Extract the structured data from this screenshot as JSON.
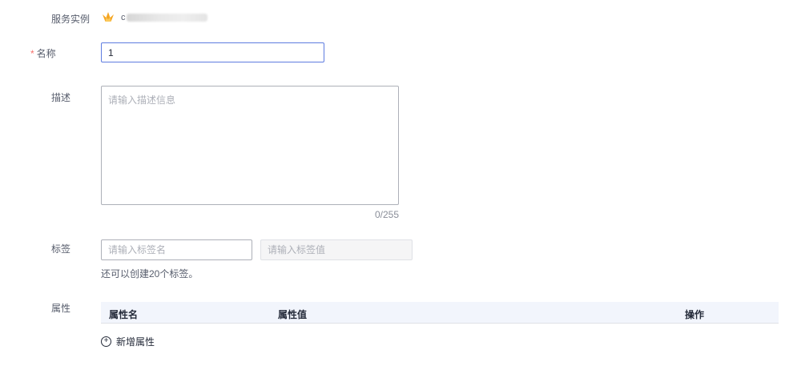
{
  "form": {
    "instance": {
      "label": "服务实例",
      "icon": "crown-icon",
      "value_prefix": "c"
    },
    "name": {
      "required_mark": "*",
      "label": "名称",
      "value": "1"
    },
    "description": {
      "label": "描述",
      "placeholder": "请输入描述信息",
      "counter": "0/255"
    },
    "tags": {
      "label": "标签",
      "key_placeholder": "请输入标签名",
      "value_placeholder": "请输入标签值",
      "hint": "还可以创建20个标签。"
    },
    "attributes": {
      "label": "属性",
      "columns": [
        "属性名",
        "属性值",
        "操作"
      ],
      "add_icon": "plus-circle-icon",
      "add_label": "新增属性"
    }
  },
  "colors": {
    "accent": "#5e7ce0",
    "required": "#f66f6a",
    "table_header_bg": "#f2f5fc",
    "crown": "#f5a623"
  }
}
